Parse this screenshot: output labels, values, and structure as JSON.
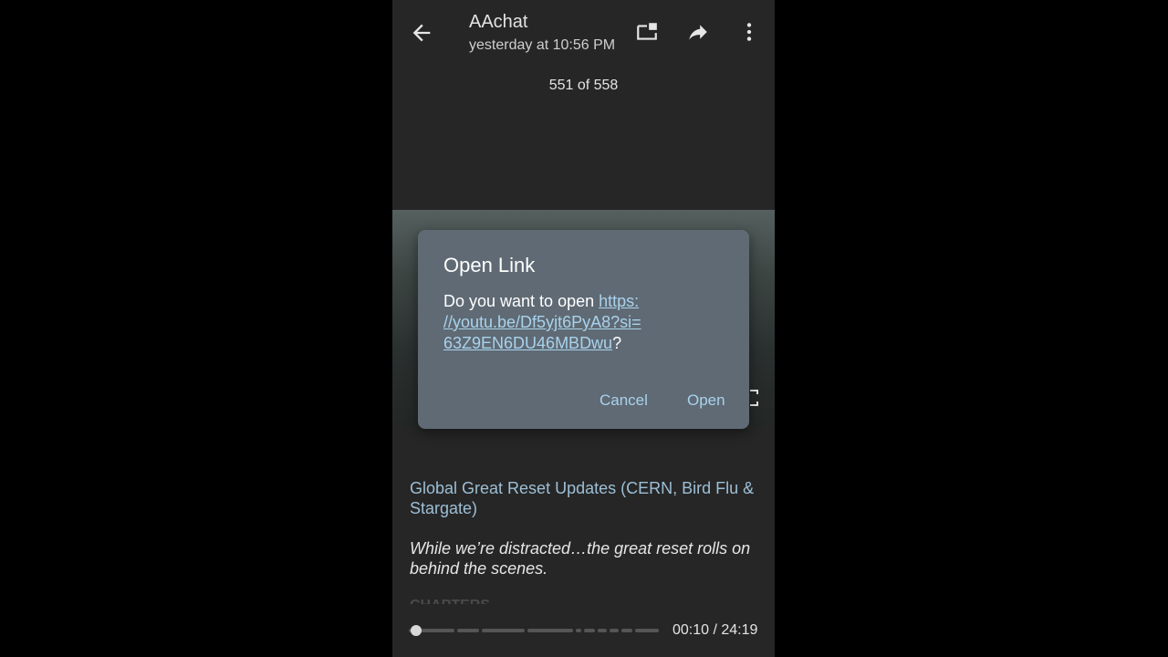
{
  "header": {
    "title": "AAchat",
    "subtitle": "yesterday at 10:56 PM",
    "counter": "551 of 558"
  },
  "dialog": {
    "title": "Open Link",
    "prompt": "Do you want to open ",
    "link_line1": "https:",
    "link_line2": "//youtu.be/Df5yjt6PyA8?si=",
    "link_line3": "63Z9EN6DU46MBDwu",
    "suffix": "?",
    "cancel_label": "Cancel",
    "open_label": "Open"
  },
  "content": {
    "video_title": "Global Great Reset Updates (CERN, Bird Flu & Stargate)",
    "video_description": "While we’re distracted…the great reset rolls on behind the scenes.",
    "chapters_heading": "CHAPTERS"
  },
  "player": {
    "time": "00:10 / 24:19",
    "progress_fraction": 0.007
  },
  "icons": {
    "back": "arrow-back-icon",
    "pip": "picture-in-picture-icon",
    "share": "share-icon",
    "more": "more-vert-icon",
    "fullscreen": "fullscreen-icon"
  },
  "colors": {
    "background": "#262626",
    "dialog": "#5f6a74",
    "accent": "#a9d2ec",
    "title_link": "#9dbfd6"
  }
}
